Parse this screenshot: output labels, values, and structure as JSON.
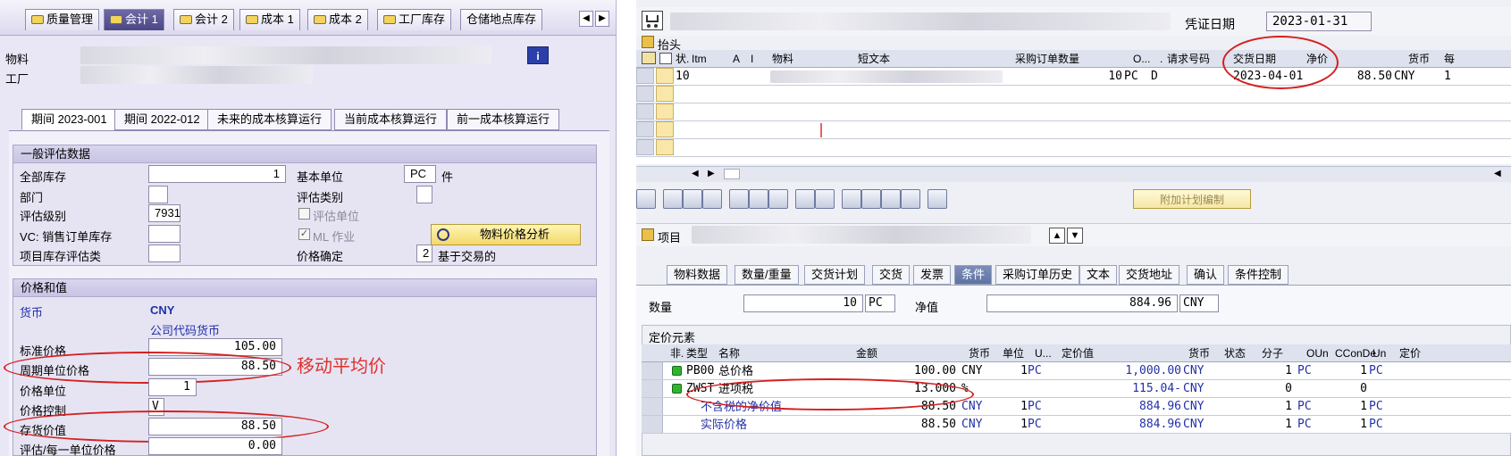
{
  "left": {
    "tabs": [
      "质量管理",
      "会计 1",
      "会计 2",
      "成本 1",
      "成本 2",
      "工厂库存",
      "仓储地点库存"
    ],
    "material_label": "物料",
    "plant_label": "工厂",
    "period_tabs": [
      "期间 2023-001",
      "期间 2022-012",
      "未来的成本核算运行",
      "当前成本核算运行",
      "前一成本核算运行"
    ],
    "general": {
      "title": "一般评估数据",
      "total_stock_label": "全部库存",
      "total_stock": "1",
      "base_unit_label": "基本单位",
      "base_unit": "PC",
      "base_unit_text": "件",
      "dept_label": "部门",
      "val_category_label": "评估类别",
      "val_class_label": "评估级别",
      "val_class": "7931",
      "val_unit_label": "评估单位",
      "vc_label": "VC: 销售订单库存",
      "ml_label": "ML 作业",
      "analysis_btn": "物料价格分析",
      "proj_label": "项目库存评估类",
      "price_det_label": "价格确定",
      "price_det": "2",
      "price_det_text": "基于交易的"
    },
    "prices": {
      "title": "价格和值",
      "currency_label": "货币",
      "currency": "CNY",
      "company_currency": "公司代码货币",
      "std_price_label": "标准价格",
      "std_price": "105.00",
      "periodic_price_label": "周期单位价格",
      "periodic_price": "88.50",
      "price_unit_label": "价格单位",
      "price_unit": "1",
      "price_control_label": "价格控制",
      "price_control": "V",
      "inventory_value_label": "存货价值",
      "inventory_value": "88.50",
      "val_per_unit_label": "评估/每一单位价格",
      "val_per_unit": "0.00"
    },
    "annotation": "移动平均价"
  },
  "right": {
    "doc_date_label": "凭证日期",
    "doc_date": "2023-01-31",
    "header_label": "抬头",
    "columns": [
      "状.",
      "Itm",
      "A",
      "I",
      "物料",
      "短文本",
      "采购订单数量",
      "O...",
      ".",
      "请求号码",
      "交货日期",
      "净价",
      "货币",
      "每"
    ],
    "row": {
      "itm": "10",
      "qty": "10",
      "unit": "PC",
      "d": "D",
      "delivery": "2023-04-01",
      "net_price": "88.50",
      "currency": "CNY",
      "per": "1"
    },
    "addl_planning": "附加计划编制",
    "item_label": "项目",
    "item_tabs": [
      "物料数据",
      "数量/重量",
      "交货计划",
      "交货",
      "发票",
      "条件",
      "采购订单历史",
      "文本",
      "交货地址",
      "确认",
      "条件控制"
    ],
    "qty_label": "数量",
    "qty": "10",
    "qty_unit": "PC",
    "net_value_label": "净值",
    "net_value": "884.96",
    "net_value_cur": "CNY",
    "pricing_title": "定价元素",
    "pricing_cols": [
      "非.",
      "类型",
      "名称",
      "金额",
      "货币",
      "单位",
      "U...",
      "定价值",
      "货币",
      "状态",
      "分子",
      "OUn",
      "CConDe",
      "Un",
      "定价"
    ],
    "pricing_rows": [
      {
        "type": "PB00",
        "name": "总价格",
        "amount": "100.00",
        "cur": "CNY",
        "unit": "1",
        "uom": "PC",
        "value": "1,000.00",
        "vcur": "CNY",
        "num": "1",
        "oun": "PC",
        "ccon": "1",
        "un": "PC"
      },
      {
        "type": "ZWST",
        "name": "进项税",
        "amount": "13.000",
        "cur": "%",
        "unit": "",
        "uom": "",
        "value": "115.04-",
        "vcur": "CNY",
        "num": "0",
        "oun": "",
        "ccon": "0",
        "un": ""
      },
      {
        "type": "",
        "name": "不含税的净价值",
        "amount": "88.50",
        "cur": "CNY",
        "unit": "1",
        "uom": "PC",
        "value": "884.96",
        "vcur": "CNY",
        "num": "1",
        "oun": "PC",
        "ccon": "1",
        "un": "PC"
      },
      {
        "type": "",
        "name": "实际价格",
        "amount": "88.50",
        "cur": "CNY",
        "unit": "1",
        "uom": "PC",
        "value": "884.96",
        "vcur": "CNY",
        "num": "1",
        "oun": "PC",
        "ccon": "1",
        "un": "PC"
      }
    ]
  }
}
